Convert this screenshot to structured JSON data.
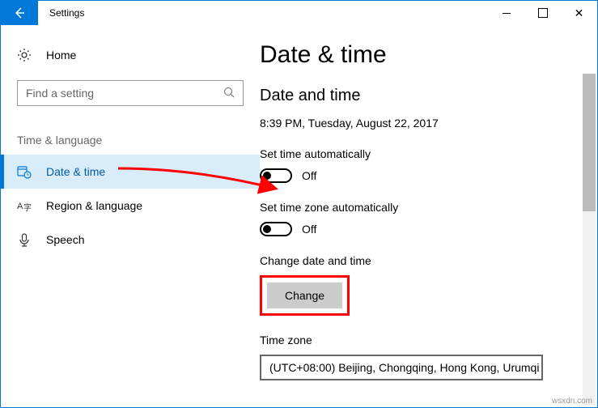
{
  "window": {
    "title": "Settings"
  },
  "sidebar": {
    "home": "Home",
    "search_placeholder": "Find a setting",
    "category": "Time & language",
    "items": [
      {
        "label": "Date & time"
      },
      {
        "label": "Region & language"
      },
      {
        "label": "Speech"
      }
    ]
  },
  "main": {
    "page_title": "Date & time",
    "section_header": "Date and time",
    "current_datetime": "8:39 PM, Tuesday, August 22, 2017",
    "set_time_auto_label": "Set time automatically",
    "set_time_auto_state": "Off",
    "set_tz_auto_label": "Set time zone automatically",
    "set_tz_auto_state": "Off",
    "change_dt_label": "Change date and time",
    "change_btn": "Change",
    "tz_label": "Time zone",
    "tz_value": "(UTC+08:00) Beijing, Chongqing, Hong Kong, Urumqi"
  },
  "watermark": "wsxdn.com"
}
